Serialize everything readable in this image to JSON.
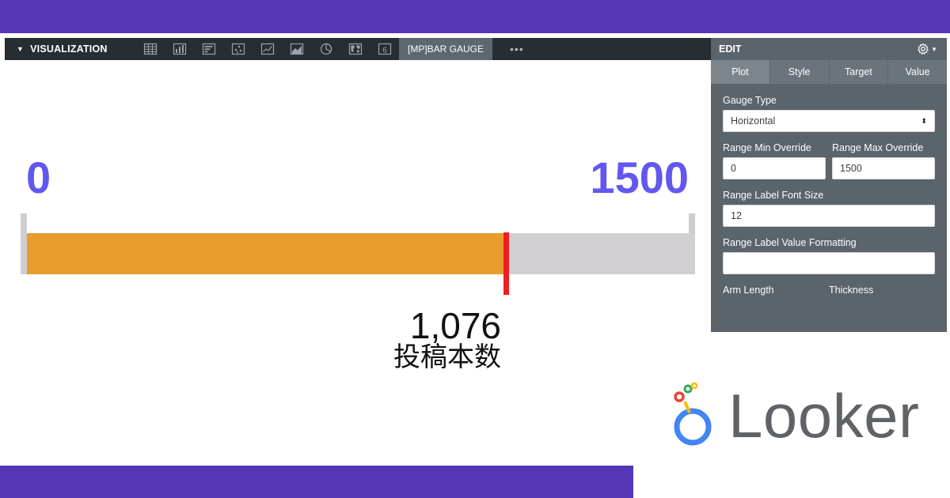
{
  "colors": {
    "brand_band": "#5637b8",
    "range_label": "#6257f0",
    "gauge_fill": "#e89c2c",
    "gauge_track": "#d2cfd3",
    "target_line": "#ef1d24"
  },
  "visualization": {
    "title": "VISUALIZATION",
    "icons": [
      "table-icon",
      "column-chart-icon",
      "bar-chart-icon",
      "scatter-icon",
      "line-chart-icon",
      "area-chart-icon",
      "pie-chart-icon",
      "map-icon",
      "single-value-icon"
    ],
    "single_value_glyph": "6",
    "active_tab": "[MP]BAR GAUGE",
    "more": "•••"
  },
  "edit": {
    "title": "EDIT",
    "tabs": [
      "Plot",
      "Style",
      "Target",
      "Value"
    ],
    "active_tab": "Plot",
    "gauge_type": {
      "label": "Gauge Type",
      "value": "Horizontal"
    },
    "range_min_override": {
      "label": "Range Min Override",
      "value": "0"
    },
    "range_max_override": {
      "label": "Range Max Override",
      "value": "1500"
    },
    "range_label_font_size": {
      "label": "Range Label Font Size",
      "value": "12"
    },
    "range_label_value_formatting": {
      "label": "Range Label Value Formatting",
      "value": ""
    },
    "arm_length": {
      "label": "Arm Length"
    },
    "thickness": {
      "label": "Thickness"
    }
  },
  "gauge": {
    "range_min": "0",
    "range_max": "1500",
    "min_value": 0,
    "max_value": 1500,
    "value": 1076,
    "value_display": "1,076",
    "value_label": "投稿本数"
  },
  "logo": {
    "word": "Looker"
  }
}
